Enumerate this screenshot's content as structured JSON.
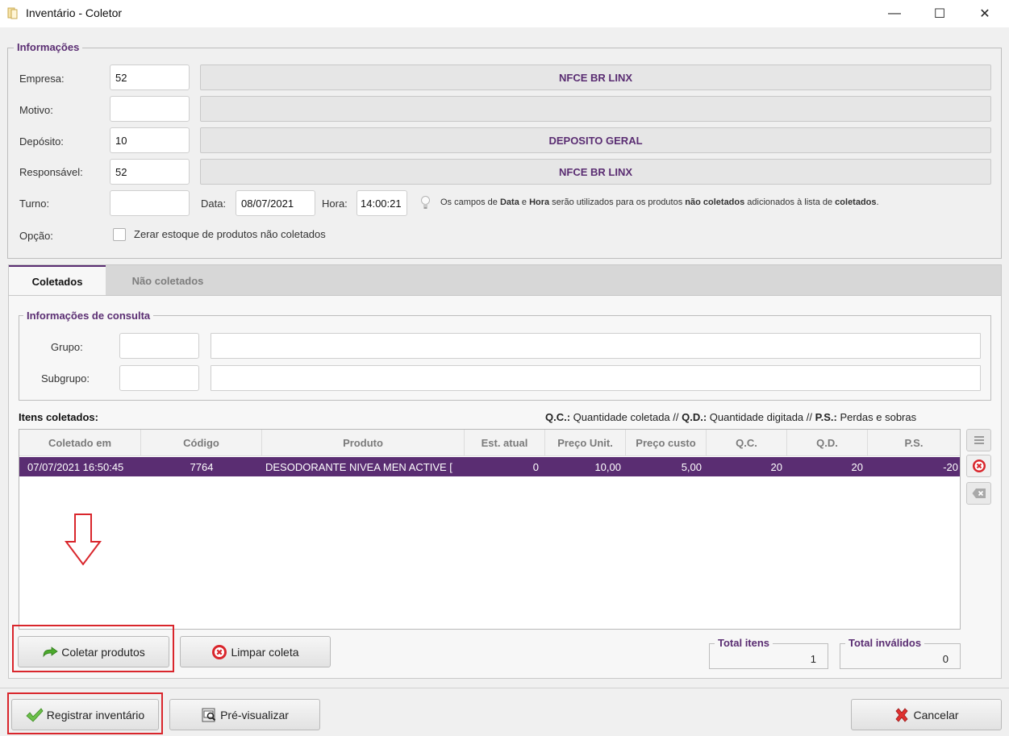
{
  "window": {
    "title": "Inventário - Coletor",
    "minimize_glyph": "—",
    "maximize_glyph": "☐",
    "close_glyph": "✕"
  },
  "informacoes": {
    "legend": "Informações",
    "empresa": {
      "label": "Empresa:",
      "code": "52",
      "name": "NFCE BR LINX"
    },
    "motivo": {
      "label": "Motivo:",
      "code": "",
      "name": ""
    },
    "deposito": {
      "label": "Depósito:",
      "code": "10",
      "name": "DEPOSITO GERAL"
    },
    "responsavel": {
      "label": "Responsável:",
      "code": "52",
      "name": "NFCE BR LINX"
    },
    "turno": {
      "label": "Turno:",
      "value": ""
    },
    "data": {
      "label": "Data:",
      "value": "08/07/2021"
    },
    "hora": {
      "label": "Hora:",
      "value": "14:00:21"
    },
    "hint": {
      "p1": "Os campos de ",
      "b1": "Data",
      "p2": " e ",
      "b2": "Hora",
      "p3": " serão utilizados para os produtos ",
      "b3": "não coletados",
      "p4": " adicionados à lista de ",
      "b4": "coletados",
      "p5": "."
    },
    "opcao": {
      "label": "Opção:",
      "checkbox_label": "Zerar estoque de produtos não coletados",
      "checked": false
    }
  },
  "tabs": [
    {
      "label": "Coletados",
      "active": true
    },
    {
      "label": "Não coletados",
      "active": false
    }
  ],
  "consulta": {
    "legend": "Informações de consulta",
    "grupo": {
      "label": "Grupo:",
      "code": "",
      "name": ""
    },
    "subgrupo": {
      "label": "Subgrupo:",
      "code": "",
      "name": ""
    }
  },
  "itens": {
    "title": "Itens coletados:",
    "legend": {
      "qc_b": "Q.C.:",
      "qc_t": " Quantidade coletada // ",
      "qd_b": "Q.D.:",
      "qd_t": " Quantidade digitada // ",
      "ps_b": "P.S.:",
      "ps_t": " Perdas e sobras"
    },
    "columns": [
      "Coletado em",
      "Código",
      "Produto",
      "Est. atual",
      "Preço Unit.",
      "Preço custo",
      "Q.C.",
      "Q.D.",
      "P.S."
    ],
    "rows": [
      [
        "07/07/2021 16:50:45",
        "7764",
        "DESODORANTE NIVEA MEN ACTIVE [",
        "0",
        "10,00",
        "5,00",
        "20",
        "20",
        "-20"
      ]
    ]
  },
  "buttons": {
    "coletar": "Coletar produtos",
    "limpar": "Limpar coleta",
    "registrar": "Registrar inventário",
    "previsualizar": "Pré-visualizar",
    "cancelar": "Cancelar"
  },
  "totals": {
    "itens": {
      "label": "Total itens",
      "value": "1"
    },
    "invalidos": {
      "label": "Total inválidos",
      "value": "0"
    }
  },
  "colors": {
    "accent": "#5a2d72",
    "highlight": "#d9262c",
    "error": "#d9262c",
    "success": "#3aa02f"
  }
}
